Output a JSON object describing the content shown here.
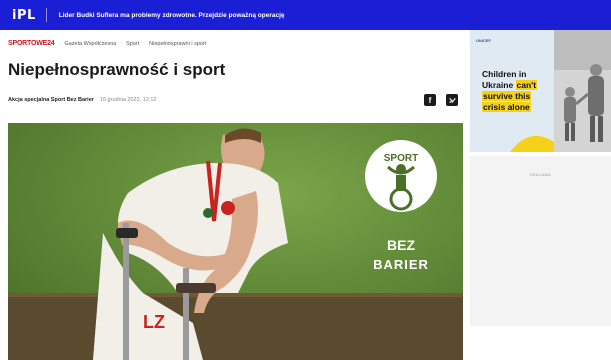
{
  "topbar": {
    "logo": "iPL",
    "ticker": "Lider Budki Suflera ma problemy zdrowotne. Przejdzie poważną operację"
  },
  "breadcrumb": {
    "brand": "SPORTOWE24",
    "items": [
      "Gazeta Współczesna",
      "Sport",
      "Niepełnosprawni i sport"
    ]
  },
  "article": {
    "title": "Niepełnosprawność i sport",
    "author": "Akcja specjalna Sport Bez Barier",
    "date": "16 grudnia 2022, 12:12",
    "share_facebook": "f",
    "share_twitter": "t"
  },
  "hero": {
    "logo_top": "SPORT",
    "logo_mid": "BEZ",
    "logo_bottom": "BARIER",
    "shirt_text": "LZ"
  },
  "ad": {
    "logo": "UNICEF",
    "line1": "Children in",
    "line2_plain": "Ukraine ",
    "line2_highlight": "can't",
    "line3_highlight": "survive this",
    "line4_highlight": "crisis alone",
    "label": "REKLAMA"
  },
  "colors": {
    "topbar": "#1a1fd6",
    "brand_red": "#d1151a",
    "hero_green": "#5d8a36",
    "ad_highlight": "#f6d11a"
  }
}
